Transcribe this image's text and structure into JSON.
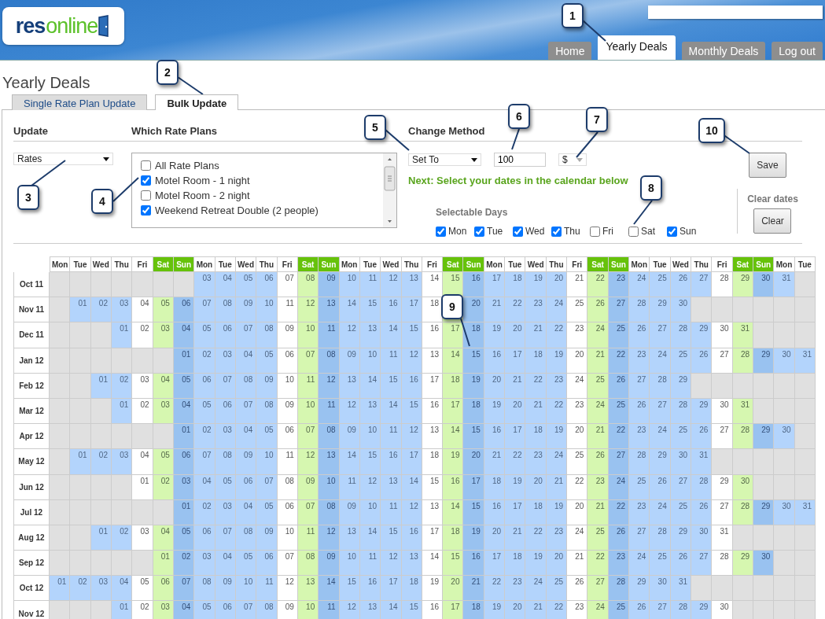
{
  "header": {
    "logo": {
      "part_1": "res",
      "part_2": "online"
    }
  },
  "nav_tabs": [
    {
      "label": "Home",
      "selected": false
    },
    {
      "label": "Yearly Deals",
      "selected": true
    },
    {
      "label": "Monthly Deals",
      "selected": false
    },
    {
      "label": "Log out",
      "selected": false
    }
  ],
  "page_title": "Yearly Deals",
  "sub_tabs": [
    {
      "label": "Single Rate Plan Update",
      "selected": false
    },
    {
      "label": "Bulk Update",
      "selected": true
    }
  ],
  "update": {
    "heading": "Update",
    "value": "Rates"
  },
  "rate_plans": {
    "heading": "Which Rate Plans",
    "items": [
      {
        "label": "All Rate Plans",
        "checked": false
      },
      {
        "label": "Motel Room - 1 night",
        "checked": true
      },
      {
        "label": "Motel Room - 2 night",
        "checked": false
      },
      {
        "label": "Weekend Retreat Double (2 people)",
        "checked": true
      }
    ]
  },
  "change_method": {
    "heading": "Change Method",
    "method": "Set To",
    "amount": "100",
    "unit": "$",
    "hint": "Next: Select your dates in the calendar below"
  },
  "selectable_days": {
    "heading": "Selectable Days",
    "days": [
      {
        "label": "Mon",
        "checked": true,
        "weekend": false
      },
      {
        "label": "Tue",
        "checked": true,
        "weekend": false
      },
      {
        "label": "Wed",
        "checked": true,
        "weekend": false
      },
      {
        "label": "Thu",
        "checked": true,
        "weekend": false
      },
      {
        "label": "Fri",
        "checked": false,
        "weekend": false
      },
      {
        "label": "Sat",
        "checked": false,
        "weekend": true
      },
      {
        "label": "Sun",
        "checked": true,
        "weekend": true
      }
    ]
  },
  "save_button": "Save",
  "clear": {
    "heading": "Clear dates",
    "button": "Clear"
  },
  "calendar": {
    "columns": [
      "Mon",
      "Tue",
      "Wed",
      "Thu",
      "Fri",
      "Sat",
      "Sun",
      "Mon",
      "Tue",
      "Wed",
      "Thu",
      "Fri",
      "Sat",
      "Sun",
      "Mon",
      "Tue",
      "Wed",
      "Thu",
      "Fri",
      "Sat",
      "Sun",
      "Mon",
      "Tue",
      "Wed",
      "Thu",
      "Fri",
      "Sat",
      "Sun",
      "Mon",
      "Tue",
      "Wed",
      "Thu",
      "Fri",
      "Sat",
      "Sun",
      "Mon",
      "Tue"
    ],
    "rows": [
      {
        "label": "Oct 11",
        "cells": [
          null,
          null,
          null,
          null,
          null,
          null,
          null,
          "03",
          "04",
          "05",
          "06",
          "07",
          "08",
          "09",
          "10",
          "11",
          "12",
          "13",
          "14",
          "15",
          "16",
          "17",
          "18",
          "19",
          "20",
          "21",
          "22",
          "23",
          "24",
          "25",
          "26",
          "27",
          "28",
          "29",
          "30",
          "31"
        ]
      },
      {
        "label": "Nov 11",
        "cells": [
          null,
          "01",
          "02",
          "03",
          "04",
          "05",
          "06",
          "07",
          "08",
          "09",
          "10",
          "11",
          "12",
          "13",
          "14",
          "15",
          "16",
          "17",
          "18",
          null,
          "20",
          "21",
          "22",
          "23",
          "24",
          "25",
          "26",
          "27",
          "28",
          "29",
          "30"
        ]
      },
      {
        "label": "Dec 11",
        "cells": [
          null,
          null,
          null,
          "01",
          "02",
          "03",
          "04",
          "05",
          "06",
          "07",
          "08",
          "09",
          "10",
          "11",
          "12",
          "13",
          "14",
          "15",
          "16",
          "17",
          "18",
          "19",
          "20",
          "21",
          "22",
          "23",
          "24",
          "25",
          "26",
          "27",
          "28",
          "29",
          "30",
          "31"
        ]
      },
      {
        "label": "Jan 12",
        "cells": [
          null,
          null,
          null,
          null,
          null,
          null,
          "01",
          "02",
          "03",
          "04",
          "05",
          "06",
          "07",
          "08",
          "09",
          "10",
          "11",
          "12",
          "13",
          "14",
          "15",
          "16",
          "17",
          "18",
          "19",
          "20",
          "21",
          "22",
          "23",
          "24",
          "25",
          "26",
          "27",
          "28",
          "29",
          "30",
          "31"
        ]
      },
      {
        "label": "Feb 12",
        "cells": [
          null,
          null,
          "01",
          "02",
          "03",
          "04",
          "05",
          "06",
          "07",
          "08",
          "09",
          "10",
          "11",
          "12",
          "13",
          "14",
          "15",
          "16",
          "17",
          "18",
          "19",
          "20",
          "21",
          "22",
          "23",
          "24",
          "25",
          "26",
          "27",
          "28",
          "29"
        ]
      },
      {
        "label": "Mar 12",
        "cells": [
          null,
          null,
          null,
          "01",
          "02",
          "03",
          "04",
          "05",
          "06",
          "07",
          "08",
          "09",
          "10",
          "11",
          "12",
          "13",
          "14",
          "15",
          "16",
          "17",
          "18",
          "19",
          "20",
          "21",
          "22",
          "23",
          "24",
          "25",
          "26",
          "27",
          "28",
          "29",
          "30",
          "31"
        ]
      },
      {
        "label": "Apr 12",
        "cells": [
          null,
          null,
          null,
          null,
          null,
          null,
          "01",
          "02",
          "03",
          "04",
          "05",
          "06",
          "07",
          "08",
          "09",
          "10",
          "11",
          "12",
          "13",
          "14",
          "15",
          "16",
          "17",
          "18",
          "19",
          "20",
          "21",
          "22",
          "23",
          "24",
          "25",
          "26",
          "27",
          "28",
          "29",
          "30"
        ]
      },
      {
        "label": "May 12",
        "cells": [
          null,
          "01",
          "02",
          "03",
          "04",
          "05",
          "06",
          "07",
          "08",
          "09",
          "10",
          "11",
          "12",
          "13",
          "14",
          "15",
          "16",
          "17",
          "18",
          "19",
          "20",
          "21",
          "22",
          "23",
          "24",
          "25",
          "26",
          "27",
          "28",
          "29",
          "30",
          "31"
        ]
      },
      {
        "label": "Jun 12",
        "cells": [
          null,
          null,
          null,
          null,
          "01",
          "02",
          "03",
          "04",
          "05",
          "06",
          "07",
          "08",
          "09",
          "10",
          "11",
          "12",
          "13",
          "14",
          "15",
          "16",
          "17",
          "18",
          "19",
          "20",
          "21",
          "22",
          "23",
          "24",
          "25",
          "26",
          "27",
          "28",
          "29",
          "30"
        ]
      },
      {
        "label": "Jul 12",
        "cells": [
          null,
          null,
          null,
          null,
          null,
          null,
          "01",
          "02",
          "03",
          "04",
          "05",
          "06",
          "07",
          "08",
          "09",
          "10",
          "11",
          "12",
          "13",
          "14",
          "15",
          "16",
          "17",
          "18",
          "19",
          "20",
          "21",
          "22",
          "23",
          "24",
          "25",
          "26",
          "27",
          "28",
          "29",
          "30",
          "31"
        ]
      },
      {
        "label": "Aug 12",
        "cells": [
          null,
          null,
          "01",
          "02",
          "03",
          "04",
          "05",
          "06",
          "07",
          "08",
          "09",
          "10",
          "11",
          "12",
          "13",
          "14",
          "15",
          "16",
          "17",
          "18",
          "19",
          "20",
          "21",
          "22",
          "23",
          "24",
          "25",
          "26",
          "27",
          "28",
          "29",
          "30",
          "31"
        ]
      },
      {
        "label": "Sep 12",
        "cells": [
          null,
          null,
          null,
          null,
          null,
          "01",
          "02",
          "03",
          "04",
          "05",
          "06",
          "07",
          "08",
          "09",
          "10",
          "11",
          "12",
          "13",
          "14",
          "15",
          "16",
          "17",
          "18",
          "19",
          "20",
          "21",
          "22",
          "23",
          "24",
          "25",
          "26",
          "27",
          "28",
          "29",
          "30"
        ]
      },
      {
        "label": "Oct 12",
        "cells": [
          "01",
          "02",
          "03",
          "04",
          "05",
          "06",
          "07",
          "08",
          "09",
          "10",
          "11",
          "12",
          "13",
          "14",
          "15",
          "16",
          "17",
          "18",
          "19",
          "20",
          "21",
          "22",
          "23",
          "24",
          "25",
          "26",
          "27",
          "28",
          "29",
          "30",
          "31"
        ]
      },
      {
        "label": "Nov 12",
        "cells": [
          null,
          null,
          null,
          "01",
          "02",
          "03",
          "04",
          "05",
          "06",
          "07",
          "08",
          "09",
          "10",
          "11",
          "12",
          "13",
          "14",
          "15",
          "16",
          "17",
          "18",
          "19",
          "20",
          "21",
          "22",
          "23",
          "24",
          "25",
          "26",
          "27",
          "28",
          "29",
          "30"
        ]
      }
    ]
  },
  "callouts": [
    "1",
    "2",
    "3",
    "4",
    "5",
    "6",
    "7",
    "8",
    "9",
    "10"
  ]
}
